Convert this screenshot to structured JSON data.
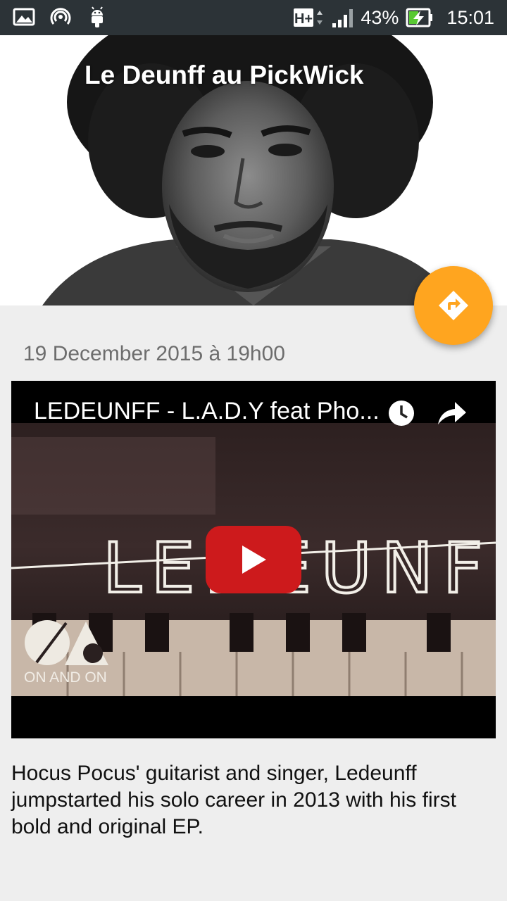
{
  "status_bar": {
    "network_type": "H+",
    "battery_percent": "43%",
    "time": "15:01",
    "icons": [
      "image-icon",
      "hotspot-icon",
      "android-icon",
      "signal-icon",
      "battery-charging-icon"
    ]
  },
  "header": {
    "title": "Le Deunff au PickWick"
  },
  "fab": {
    "icon": "directions-icon",
    "color": "#ffa51f"
  },
  "event": {
    "date_time": "19 December 2015 à 19h00",
    "description": "Hocus Pocus' guitarist and singer, Ledeunff jumpstarted his solo career in 2013 with his first bold and original EP."
  },
  "video": {
    "title": "LEDEUNFF - L.A.D.Y feat Pho...",
    "frame_text": "LEDEUNFF",
    "channel_name": "ON AND ON",
    "play_color": "#cd1a1c"
  }
}
